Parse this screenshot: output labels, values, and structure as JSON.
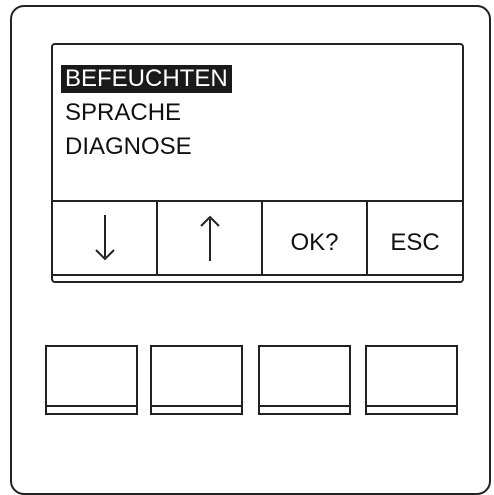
{
  "menu": {
    "items": [
      {
        "label": "BEFEUCHTEN",
        "selected": true
      },
      {
        "label": "SPRACHE",
        "selected": false
      },
      {
        "label": "DIAGNOSE",
        "selected": false
      }
    ]
  },
  "soft_keys": [
    {
      "icon": "arrow-down-icon"
    },
    {
      "icon": "arrow-up-icon"
    },
    {
      "label": "OK?"
    },
    {
      "label": "ESC"
    }
  ],
  "hardware_keys_count": 4,
  "colors": {
    "line": "#222222",
    "highlight": "#1a1a1a",
    "background": "#ffffff"
  }
}
